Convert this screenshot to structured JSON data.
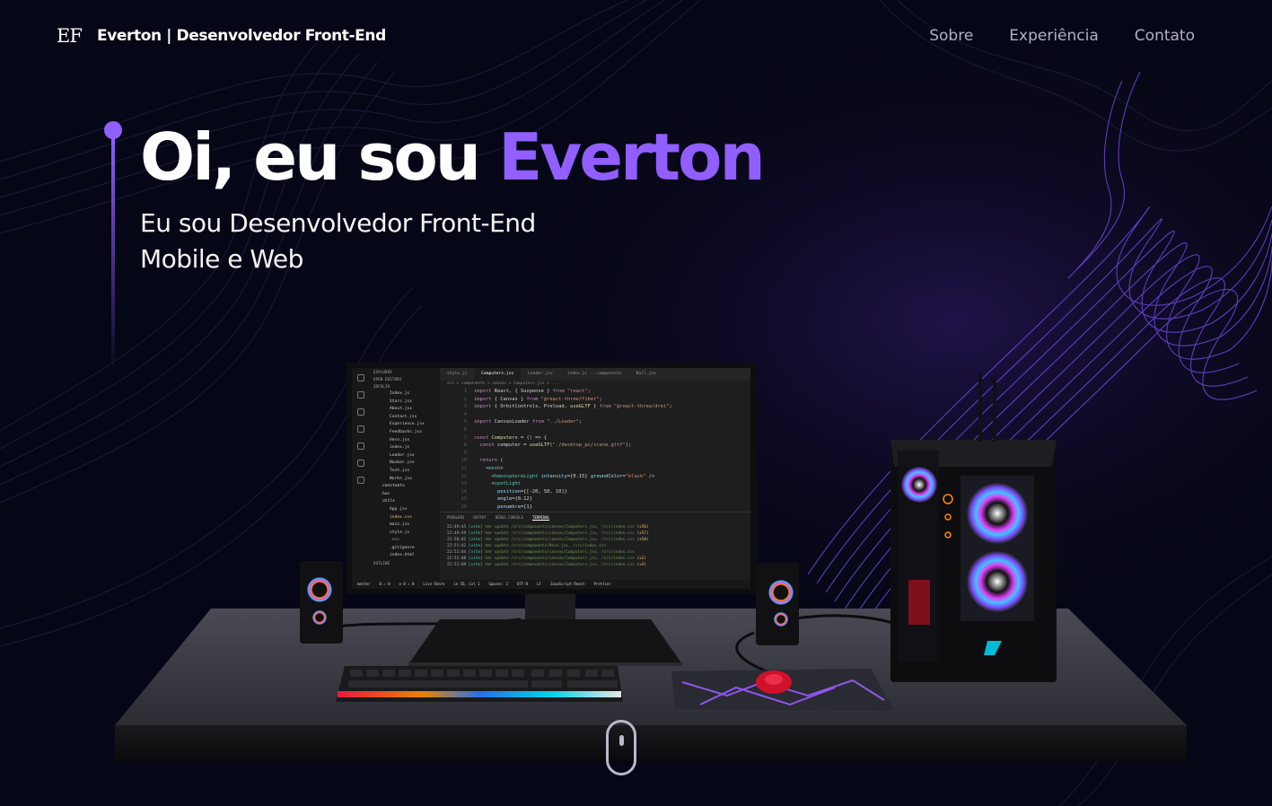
{
  "nav": {
    "logo": "EF",
    "brand": "Everton | Desenvolvedor Front-End",
    "links": [
      "Sobre",
      "Experiência",
      "Contato"
    ]
  },
  "hero": {
    "greeting": "Oi, eu sou ",
    "name": "Everton",
    "subtitle_line1": "Eu sou Desenvolvedor Front-End",
    "subtitle_line2": "Mobile e Web"
  },
  "colors": {
    "background": "#060716",
    "accent": "#915eff",
    "nav_text": "#aeb0c4"
  },
  "monitor": {
    "explorer_title": "EXPLORER",
    "open_editors": "OPEN EDITORS",
    "project": "3DFOLIO",
    "files": [
      {
        "name": "Index.js",
        "kind": "file"
      },
      {
        "name": "Stars.jsx",
        "kind": "file"
      },
      {
        "name": "About.jsx",
        "kind": "file"
      },
      {
        "name": "Contact.jsx",
        "kind": "file"
      },
      {
        "name": "Experience.jsx",
        "kind": "file"
      },
      {
        "name": "Feedbacks.jsx",
        "kind": "file"
      },
      {
        "name": "Hero.jsx",
        "kind": "file"
      },
      {
        "name": "index.js",
        "kind": "file"
      },
      {
        "name": "Loader.jsx",
        "kind": "file"
      },
      {
        "name": "Navbar.jsx",
        "kind": "file"
      },
      {
        "name": "Tech.jsx",
        "kind": "file"
      },
      {
        "name": "Works.jsx",
        "kind": "file"
      },
      {
        "name": "constants",
        "kind": "folder"
      },
      {
        "name": "hoc",
        "kind": "folder"
      },
      {
        "name": "utils",
        "kind": "folder"
      },
      {
        "name": "App.jsx",
        "kind": "file"
      },
      {
        "name": "index.css",
        "kind": "sel"
      },
      {
        "name": "main.jsx",
        "kind": "file"
      },
      {
        "name": "style.js",
        "kind": "file"
      },
      {
        "name": ".env",
        "kind": "dim"
      },
      {
        "name": ".gitignore",
        "kind": "file"
      },
      {
        "name": "index.html",
        "kind": "file"
      }
    ],
    "outline": "OUTLINE",
    "tabs": [
      "style.js",
      "Computers.jsx",
      "Loader.jsx",
      "index.js ...components",
      "Ball.jsx"
    ],
    "active_tab": "Computers.jsx",
    "breadcrumb": "src > components > canvas > Computers.jsx > ...",
    "code": [
      {
        "n": "1",
        "t": "import React, { Suspense } from \"react\";"
      },
      {
        "n": "2",
        "t": "import { Canvas } from \"@react-three/fiber\";"
      },
      {
        "n": "3",
        "t": "import { OrbitControls, Preload, useGLTF } from \"@react-three/drei\";"
      },
      {
        "n": "4",
        "t": ""
      },
      {
        "n": "5",
        "t": "import CanvasLoader from \"../Loader\";"
      },
      {
        "n": "6",
        "t": ""
      },
      {
        "n": "7",
        "t": "const Computers = () => {"
      },
      {
        "n": "8",
        "t": "  const computer = useGLTF(\"./desktop_pc/scene.gltf\");"
      },
      {
        "n": "9",
        "t": ""
      },
      {
        "n": "10",
        "t": "  return ("
      },
      {
        "n": "11",
        "t": "    <mesh>"
      },
      {
        "n": "12",
        "t": "      <hemisphereLight intensity={0.15} groundColor=\"black\" />"
      },
      {
        "n": "13",
        "t": "      <spotLight"
      },
      {
        "n": "14",
        "t": "        position={[-20, 50, 10]}"
      },
      {
        "n": "15",
        "t": "        angle={0.12}"
      },
      {
        "n": "16",
        "t": "        penumbra={1}"
      }
    ],
    "panel_tabs": [
      "PROBLEMS",
      "OUTPUT",
      "DEBUG CONSOLE",
      "TERMINAL"
    ],
    "terminal": [
      {
        "time": "22:49:45",
        "msg": "hmr update /src/components/canvas/Computers.jsx, /src/index.css",
        "count": "(x56)"
      },
      {
        "time": "22:49:49",
        "msg": "hmr update /src/components/canvas/Computers.jsx, /src/index.css",
        "count": "(x57)"
      },
      {
        "time": "22:50:02",
        "msg": "hmr update /src/components/canvas/Computers.jsx, /src/index.css",
        "count": "(x58)"
      },
      {
        "time": "22:51:42",
        "msg": "hmr update /src/components/Hero.jsx, /src/index.css",
        "count": ""
      },
      {
        "time": "22:52:04",
        "msg": "hmr update /src/components/canvas/Computers.jsx, /src/index.css",
        "count": ""
      },
      {
        "time": "22:52:08",
        "msg": "hmr update /src/components/canvas/Computers.jsx, /src/index.css",
        "count": "(x2)"
      },
      {
        "time": "22:52:09",
        "msg": "hmr update /src/components/canvas/Computers.jsx, /src/index.css",
        "count": "(x3)"
      }
    ],
    "status_left": [
      "master",
      "0 ⚠ 0",
      "⊘ 0 ⚠ 0",
      "Live Share"
    ],
    "status_right": [
      "Ln 56, Col 1",
      "Spaces: 2",
      "UTF-8",
      "LF",
      "JavaScript React",
      "Prettier"
    ]
  }
}
